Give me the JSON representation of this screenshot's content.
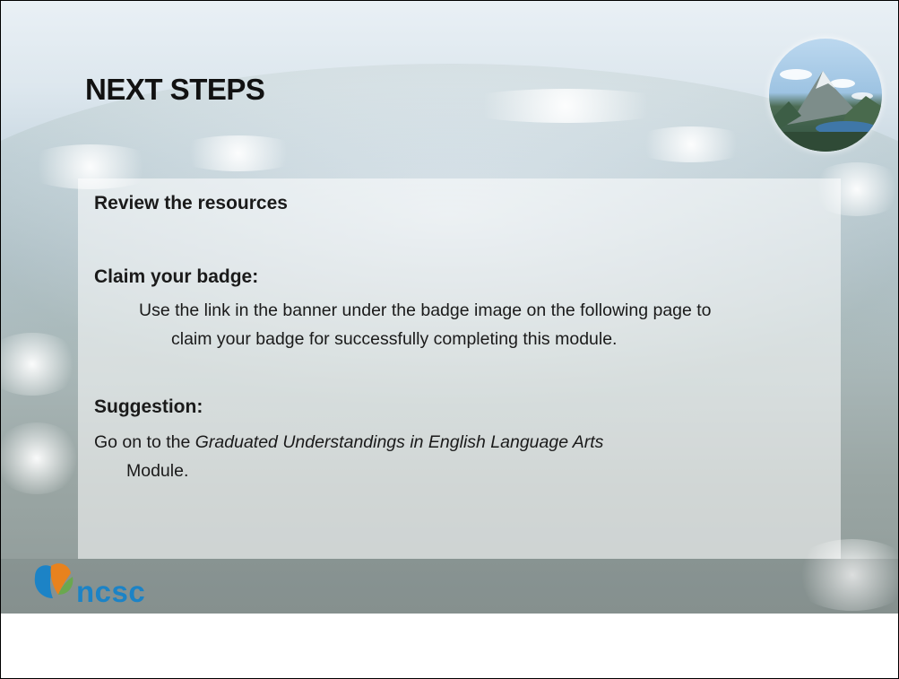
{
  "slide": {
    "title": "NEXT STEPS",
    "sections": [
      {
        "heading": "Review the resources"
      },
      {
        "heading": "Claim your badge:",
        "line1": "Use the link in the banner under the badge image on the following page to",
        "line2": "claim your badge for successfully completing this module."
      },
      {
        "heading": "Suggestion:",
        "prefix": "Go on to the ",
        "italic": "Graduated Understandings in English Language Arts",
        "line2": "Module."
      }
    ]
  },
  "logo": {
    "text": "ncsc",
    "colors": [
      "#e8821e",
      "#1c83c6",
      "#6aa84f"
    ]
  },
  "icons": [
    "mountain-badge-icon",
    "ncsc-leaf-icon"
  ]
}
